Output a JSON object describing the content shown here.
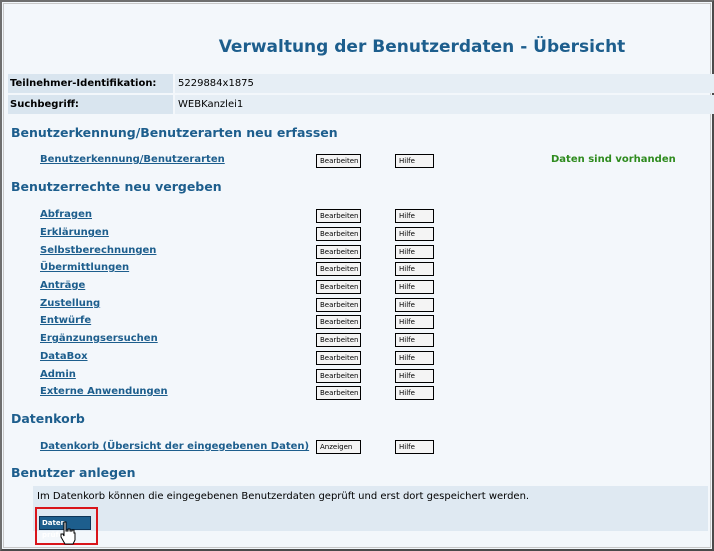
{
  "page": {
    "title": "Verwaltung der Benutzerdaten - Übersicht"
  },
  "info": {
    "participant_label": "Teilnehmer-Identifikation:",
    "participant_value": "5229884x1875",
    "search_label": "Suchbegriff:",
    "search_value": "WEBKanzlei1"
  },
  "sections": {
    "s1": "Benutzerkennung/Benutzerarten neu erfassen",
    "s2": "Benutzerrechte neu vergeben",
    "s3": "Datenkorb",
    "s4": "Benutzer anlegen"
  },
  "labels": {
    "edit": "Bearbeiten",
    "help": "Hilfe",
    "show": "Anzeigen"
  },
  "user_id_row": {
    "link": "Benutzerkennung/Benutzerarten",
    "status": "Daten sind vorhanden",
    "status_color": "#2e8b1e"
  },
  "rights": [
    "Abfragen",
    "Erklärungen",
    "Selbstberechnungen",
    "Übermittlungen",
    "Anträge",
    "Zustellung",
    "Entwürfe",
    "Ergänzungsersuchen",
    "DataBox",
    "Admin",
    "Externe Anwendungen"
  ],
  "datenkorb": {
    "link": "Datenkorb (Übersicht der eingegebenen Daten)"
  },
  "anlegen": {
    "note": "Im Datenkorb können die eingegebenen Benutzerdaten geprüft und erst dort gespeichert werden.",
    "button": "Daten prüfen"
  },
  "colors": {
    "accent": "#1d5e8d",
    "highlight": "#d9151b"
  }
}
